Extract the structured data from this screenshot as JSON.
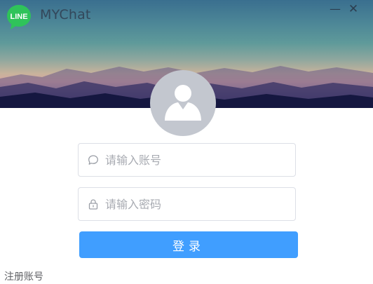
{
  "window": {
    "title": "MYChat",
    "minimize_symbol": "—",
    "close_symbol": "✕"
  },
  "logo": {
    "text": "LINE",
    "icon": "line-logo-icon",
    "color": "#2fc35a"
  },
  "avatar": {
    "icon": "user-silhouette-icon"
  },
  "form": {
    "account_placeholder": "请输入账号",
    "account_icon": "chat-bubble-icon",
    "password_placeholder": "请输入密码",
    "password_icon": "lock-icon",
    "login_label": "登录"
  },
  "footer": {
    "register_label": "注册账号"
  },
  "colors": {
    "accent": "#409eff",
    "avatar_bg": "#c3c7cf",
    "input_border": "#dcdfe6"
  }
}
